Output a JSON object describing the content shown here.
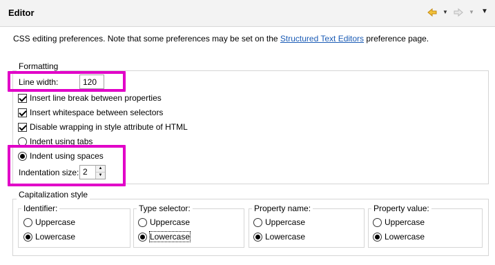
{
  "header": {
    "title": "Editor",
    "back_icon": "arrow-left-icon",
    "forward_icon": "arrow-right-icon",
    "menu_icon": "view-menu-icon"
  },
  "description": {
    "before": "CSS editing preferences.  Note that some preferences may be set on the ",
    "link": "Structured Text Editors",
    "after": " preference page."
  },
  "formatting": {
    "title": "Formatting",
    "line_width_label": "Line width:",
    "line_width_value": "120",
    "options": [
      {
        "label": "Insert line break between properties",
        "checked": true
      },
      {
        "label": "Insert whitespace between selectors",
        "checked": true
      },
      {
        "label": "Disable wrapping in style attribute of HTML",
        "checked": true
      }
    ],
    "indent_tabs_label": "Indent using tabs",
    "indent_spaces_label": "Indent using spaces",
    "indent_mode": "spaces",
    "indent_size_label": "Indentation size:",
    "indent_size_value": "2"
  },
  "capitalization": {
    "title": "Capitalization style",
    "groups": [
      {
        "title": "Identifier:",
        "upper": "Uppercase",
        "lower": "Lowercase",
        "selected": "lower"
      },
      {
        "title": "Type selector:",
        "upper": "Uppercase",
        "lower": "Lowercase",
        "selected": "lower"
      },
      {
        "title": "Property name:",
        "upper": "Uppercase",
        "lower": "Lowercase",
        "selected": "lower"
      },
      {
        "title": "Property value:",
        "upper": "Uppercase",
        "lower": "Lowercase",
        "selected": "lower"
      }
    ]
  },
  "colors": {
    "highlight": "#e100c8",
    "link": "#1a5bb5",
    "back_arrow": "#e6a817"
  }
}
